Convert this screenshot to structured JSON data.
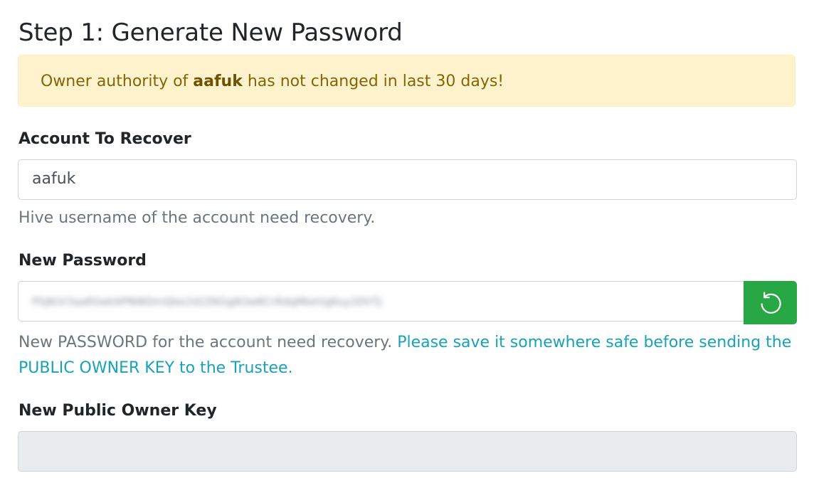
{
  "title": "Step 1: Generate New Password",
  "alert": {
    "prefix": "Owner authority of ",
    "account": "aafuk",
    "suffix": " has not changed in last 30 days!"
  },
  "account_field": {
    "label": "Account To Recover",
    "value": "aafuk",
    "help": "Hive username of the account need recovery."
  },
  "password_field": {
    "label": "New Password",
    "value": "P5JKtV3aaRSwk6PNWDmQbe2d2ZKGgN3wKCrRdqMkeVgKuy2DVTJ",
    "button_icon": "refresh-icon",
    "help_prefix": "New PASSWORD for the account need recovery. ",
    "help_info_line1": "Please save it somewhere safe before sending the",
    "help_info_line2": "PUBLIC OWNER KEY to the Trustee."
  },
  "owner_key_field": {
    "label": "New Public Owner Key",
    "value": ""
  },
  "colors": {
    "alert_bg": "#fff3cd",
    "alert_text": "#856404",
    "success": "#28a745",
    "info": "#17a2b8",
    "muted": "#6c757d"
  }
}
